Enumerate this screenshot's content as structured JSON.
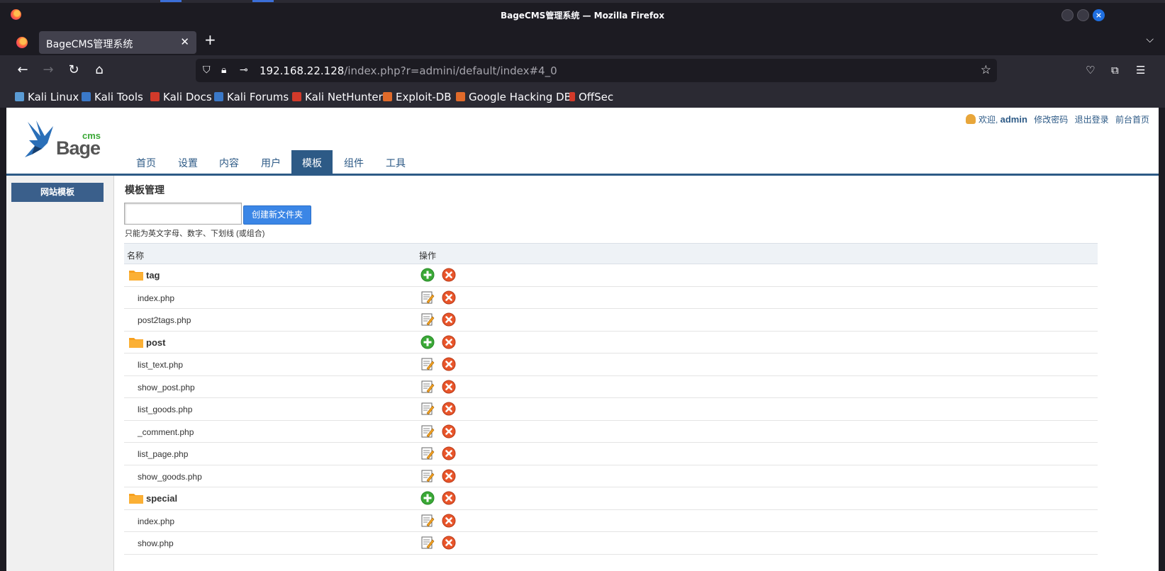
{
  "browser": {
    "window_title": "BageCMS管理系统 — Mozilla Firefox",
    "tab_title": "BageCMS管理系统",
    "url_host": "192.168.22.128",
    "url_path": "/index.php?r=admini/default/index#4_0",
    "bookmarks": [
      {
        "label": "Kali Linux",
        "color": "#5a9bd4"
      },
      {
        "label": "Kali Tools",
        "color": "#3a78c8"
      },
      {
        "label": "Kali Docs",
        "color": "#d23a2a"
      },
      {
        "label": "Kali Forums",
        "color": "#3a78c8"
      },
      {
        "label": "Kali NetHunter",
        "color": "#d23a2a"
      },
      {
        "label": "Exploit-DB",
        "color": "#e06a2a"
      },
      {
        "label": "Google Hacking DB",
        "color": "#e06a2a"
      },
      {
        "label": "OffSec",
        "color": "#d23a2a"
      }
    ]
  },
  "header": {
    "logo_cms": "cms",
    "logo_bage": "Bage",
    "welcome": "欢迎,",
    "username": "admin",
    "links": [
      "修改密码",
      "退出登录",
      "前台首页"
    ],
    "nav": [
      "首页",
      "设置",
      "内容",
      "用户",
      "模板",
      "组件",
      "工具"
    ],
    "active_nav": "模板"
  },
  "sidebar": {
    "items": [
      "网站模板"
    ]
  },
  "main": {
    "title": "模板管理",
    "create_button": "创建新文件夹",
    "hint": "只能为英文字母、数字、下划线 (或组合)",
    "columns": [
      "名称",
      "操作"
    ],
    "rows": [
      {
        "name": "tag",
        "type": "folder"
      },
      {
        "name": "index.php",
        "type": "file"
      },
      {
        "name": "post2tags.php",
        "type": "file"
      },
      {
        "name": "post",
        "type": "folder"
      },
      {
        "name": "list_text.php",
        "type": "file"
      },
      {
        "name": "show_post.php",
        "type": "file"
      },
      {
        "name": "list_goods.php",
        "type": "file"
      },
      {
        "name": "_comment.php",
        "type": "file"
      },
      {
        "name": "list_page.php",
        "type": "file"
      },
      {
        "name": "show_goods.php",
        "type": "file"
      },
      {
        "name": "special",
        "type": "folder"
      },
      {
        "name": "index.php",
        "type": "file"
      },
      {
        "name": "show.php",
        "type": "file"
      }
    ]
  },
  "colors": {
    "nav_active": "#2d5a86",
    "button": "#3b86e6",
    "add_icon": "#3aa836",
    "delete_icon": "#e8552a",
    "folder": "#f7a01e"
  }
}
